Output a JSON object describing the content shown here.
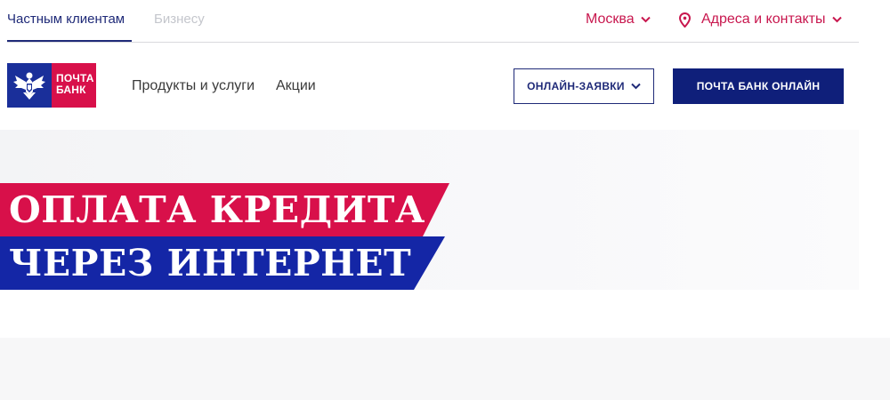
{
  "topbar": {
    "segments": [
      {
        "label": "Частным клиентам",
        "active": true
      },
      {
        "label": "Бизнесу",
        "active": false
      }
    ],
    "city": "Москва",
    "contacts": "Адреса и контакты"
  },
  "header": {
    "logo": {
      "line1": "ПОЧТА",
      "line2": "БАНК"
    },
    "nav": [
      "Продукты и услуги",
      "Акции"
    ],
    "apps_button": "ОНЛАЙН-ЗАЯВКИ",
    "online_button": "ПОЧТА БАНК ОНЛАЙН"
  },
  "hero": {
    "line1": "ОПЛАТА КРЕДИТА",
    "line2": "ЧЕРЕЗ ИНТЕРНЕТ"
  },
  "colors": {
    "brand_blue": "#1a2f9a",
    "brand_red": "#d8104a",
    "accent_red": "#c8174e",
    "nav_blue": "#1f2a78"
  },
  "icons": {
    "city": "chevron-down-icon",
    "contacts": "location-pin-icon",
    "logo": "double-eagle-icon"
  }
}
